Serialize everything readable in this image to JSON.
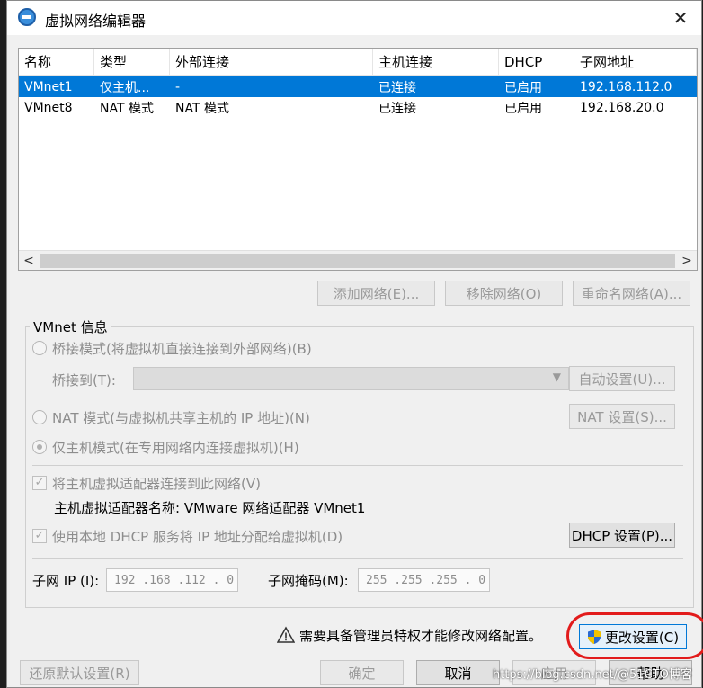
{
  "window": {
    "title": "虚拟网络编辑器",
    "close": "✕"
  },
  "table": {
    "headers": [
      "名称",
      "类型",
      "外部连接",
      "主机连接",
      "DHCP",
      "子网地址"
    ],
    "rows": [
      [
        "VMnet1",
        "仅主机...",
        "-",
        "已连接",
        "已启用",
        "192.168.112.0"
      ],
      [
        "VMnet8",
        "NAT 模式",
        "NAT 模式",
        "已连接",
        "已启用",
        "192.168.20.0"
      ]
    ],
    "scroll_left": "<",
    "scroll_right": ">"
  },
  "buttons": {
    "add_network": "添加网络(E)...",
    "remove_network": "移除网络(O)",
    "rename_network": "重命名网络(A)..."
  },
  "vmnet_info": {
    "title": "VMnet 信息",
    "bridge_mode": "桥接模式(将虚拟机直接连接到外部网络)(B)",
    "bridge_to": "桥接到(T):",
    "auto_settings": "自动设置(U)...",
    "nat_mode": "NAT 模式(与虚拟机共享主机的 IP 地址)(N)",
    "nat_settings": "NAT 设置(S)...",
    "host_only_mode": "仅主机模式(在专用网络内连接虚拟机)(H)",
    "connect_adapter": "将主机虚拟适配器连接到此网络(V)",
    "adapter_name": "主机虚拟适配器名称: VMware 网络适配器 VMnet1",
    "use_dhcp": "使用本地 DHCP 服务将 IP 地址分配给虚拟机(D)",
    "dhcp_settings": "DHCP 设置(P)...",
    "subnet_ip_label": "子网 IP (I):",
    "subnet_ip_value": "192 .168 .112 . 0",
    "subnet_mask_label": "子网掩码(M):",
    "subnet_mask_value": "255 .255 .255 . 0"
  },
  "footer": {
    "admin_warning": "需要具备管理员特权才能修改网络配置。",
    "change_settings": "更改设置(C)",
    "restore_defaults": "还原默认设置(R)",
    "ok": "确定",
    "cancel": "取消",
    "apply": "应用",
    "help": "帮助"
  },
  "watermark": "https://blog.csdn.net/@51CTO博客",
  "colors": {
    "selection": "#0078d7",
    "annotation": "#e21b1b",
    "shield_blue": "#2a6bd1",
    "shield_yellow": "#f2c200"
  }
}
